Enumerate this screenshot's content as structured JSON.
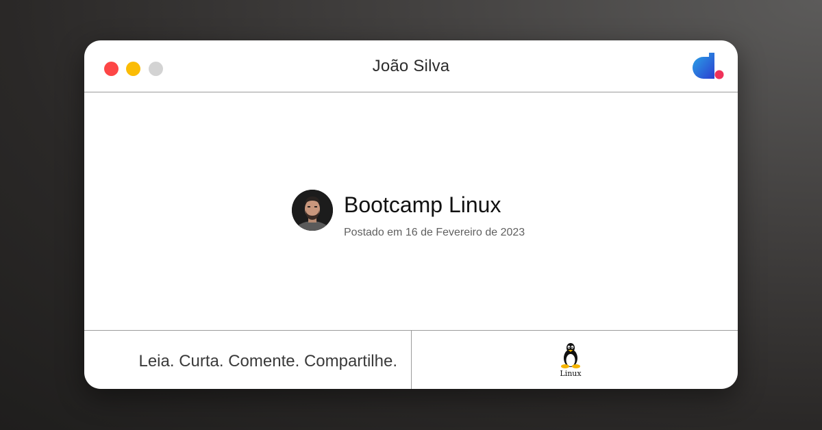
{
  "window": {
    "title": "João Silva",
    "controls": [
      "close",
      "minimize",
      "maximize"
    ]
  },
  "brand": {
    "logo_icon": "dio-logo-icon",
    "colors": {
      "close": "#fd4646",
      "minimize": "#fbbc05",
      "maximize": "#d3d3d3",
      "logo_blue": "#1e88d8",
      "logo_dot": "#f0325a"
    }
  },
  "post": {
    "title": "Bootcamp Linux",
    "date": "Postado em 16 de Fevereiro de 2023",
    "avatar_icon": "author-avatar"
  },
  "footer": {
    "tagline": "Leia. Curta. Comente. Compartilhe.",
    "tag_icon": "tux-penguin-icon",
    "tag_label": "Linux"
  }
}
